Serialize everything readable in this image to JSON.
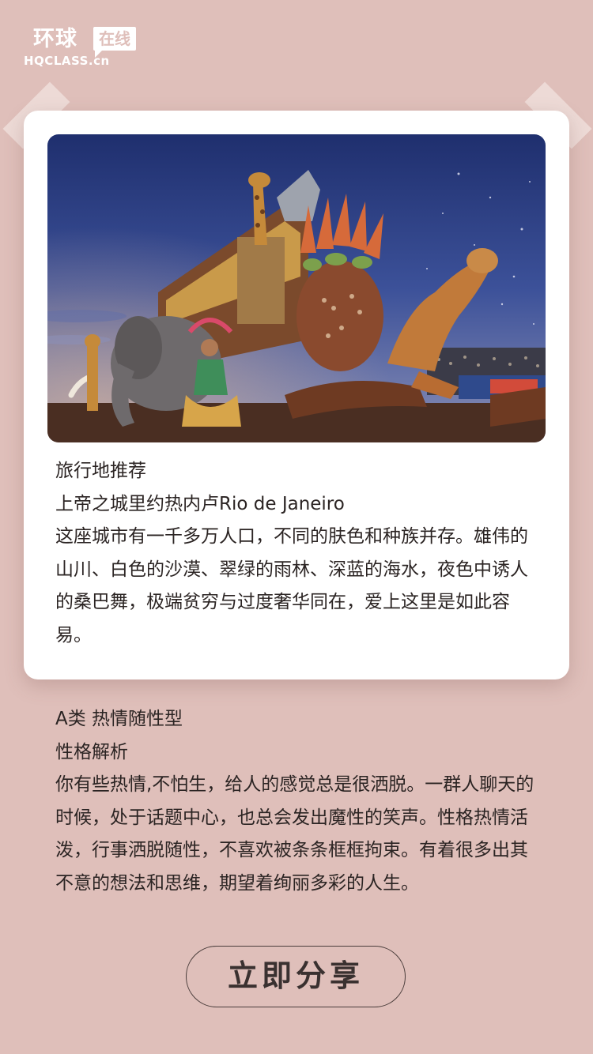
{
  "logo": {
    "cn": "环球",
    "badge": "在线",
    "en": "HQCLASS.cn"
  },
  "card": {
    "image_alt": "Rio de Janeiro carnival float with elephant, giraffe and jaguar sculptures",
    "category": "旅行地推荐",
    "title": "上帝之城里约热内卢Rio de Janeiro",
    "description": "这座城市有一千多万人口，不同的肤色和种族并存。雄伟的山川、白色的沙漠、翠绿的雨林、深蓝的海水，夜色中诱人的桑巴舞，极端贫穷与过度奢华同在，爱上这里是如此容易。"
  },
  "result": {
    "type_label": "A类 热情随性型",
    "analysis_heading": "性格解析",
    "analysis_text": "你有些热情,不怕生，给人的感觉总是很洒脱。一群人聊天的时候，处于话题中心，也总会发出魔性的笑声。性格热情活泼，行事洒脱随性，不喜欢被条条框框拘束。有着很多出其不意的想法和思维，期望着绚丽多彩的人生。"
  },
  "share_button": {
    "label": "立即分享"
  },
  "colors": {
    "background": "#dfbfba",
    "card": "#ffffff",
    "text": "#2b2423",
    "button_border": "#4a3d3b"
  }
}
